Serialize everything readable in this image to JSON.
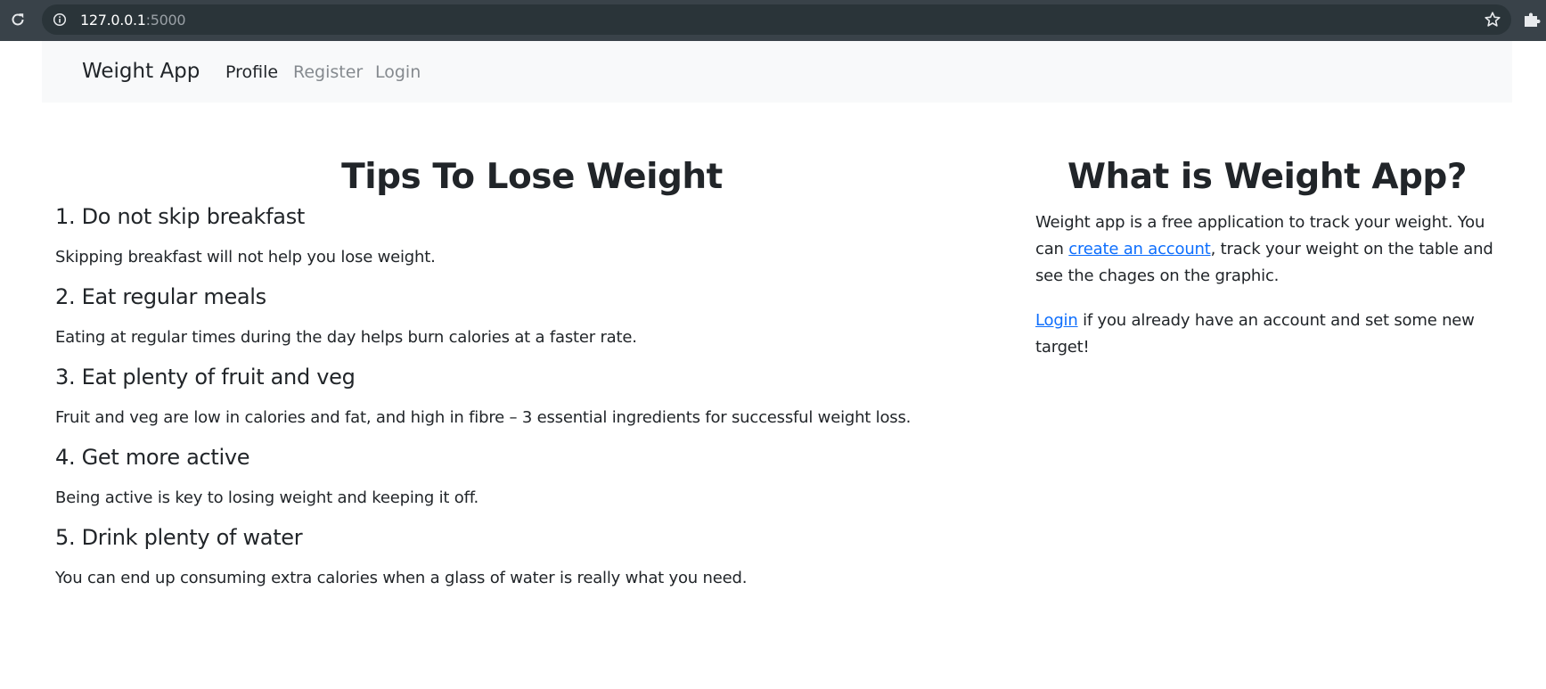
{
  "browser": {
    "url_host": "127.0.0.1",
    "url_port": ":5000"
  },
  "navbar": {
    "brand": "Weight App",
    "links": [
      {
        "label": "Profile"
      },
      {
        "label": "Register"
      },
      {
        "label": "Login"
      }
    ]
  },
  "tips": {
    "title": "Tips To Lose Weight",
    "items": [
      {
        "heading": "1. Do not skip breakfast",
        "text": "Skipping breakfast will not help you lose weight."
      },
      {
        "heading": "2. Eat regular meals",
        "text": "Eating at regular times during the day helps burn calories at a faster rate."
      },
      {
        "heading": "3. Eat plenty of fruit and veg",
        "text": "Fruit and veg are low in calories and fat, and high in fibre – 3 essential ingredients for successful weight loss."
      },
      {
        "heading": "4. Get more active",
        "text": "Being active is key to losing weight and keeping it off."
      },
      {
        "heading": "5. Drink plenty of water",
        "text": "You can end up consuming extra calories when a glass of water is really what you need."
      }
    ]
  },
  "about": {
    "title": "What is Weight App?",
    "para1_before": "Weight app is a free application to track your weight. You can ",
    "para1_link": "create an account",
    "para1_after": ", track your weight on the table and see the chages on the graphic.",
    "para2_link": "Login",
    "para2_after": " if you already have an account and set some new target!"
  },
  "icons": {
    "reload": "reload-icon",
    "info": "info-icon",
    "star": "star-icon",
    "extensions": "puzzle-icon"
  }
}
